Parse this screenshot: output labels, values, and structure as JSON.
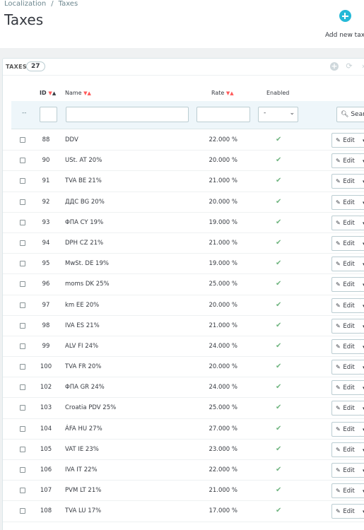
{
  "breadcrumb": {
    "items": [
      "Localization",
      "Taxes"
    ],
    "separator": "/"
  },
  "page_title": "Taxes",
  "add_button": {
    "label": "Add new tax",
    "icon": "plus-circle-icon"
  },
  "panel": {
    "title": "TAXES",
    "count": "27",
    "tools": [
      "add-icon",
      "refresh-icon",
      "chevron-right-icon"
    ]
  },
  "columns": {
    "id": "ID",
    "name": "Name",
    "rate": "Rate",
    "enabled": "Enabled"
  },
  "filters": {
    "dash": "--",
    "enabled_value": "-",
    "search_label": "Search"
  },
  "colors": {
    "accent": "#25b9d7",
    "check": "#70b580",
    "sort": "#ff5a5a"
  },
  "rows": [
    {
      "id": "88",
      "name": "DDV",
      "rate": "22.000 %",
      "enabled": true
    },
    {
      "id": "90",
      "name": "USt. AT 20%",
      "rate": "20.000 %",
      "enabled": true
    },
    {
      "id": "91",
      "name": "TVA BE 21%",
      "rate": "21.000 %",
      "enabled": true
    },
    {
      "id": "92",
      "name": "ДДС BG 20%",
      "rate": "20.000 %",
      "enabled": true
    },
    {
      "id": "93",
      "name": "ΦΠΑ CY 19%",
      "rate": "19.000 %",
      "enabled": true
    },
    {
      "id": "94",
      "name": "DPH CZ 21%",
      "rate": "21.000 %",
      "enabled": true
    },
    {
      "id": "95",
      "name": "MwSt. DE 19%",
      "rate": "19.000 %",
      "enabled": true
    },
    {
      "id": "96",
      "name": "moms DK 25%",
      "rate": "25.000 %",
      "enabled": true
    },
    {
      "id": "97",
      "name": "km EE 20%",
      "rate": "20.000 %",
      "enabled": true
    },
    {
      "id": "98",
      "name": "IVA ES 21%",
      "rate": "21.000 %",
      "enabled": true
    },
    {
      "id": "99",
      "name": "ALV FI 24%",
      "rate": "24.000 %",
      "enabled": true
    },
    {
      "id": "100",
      "name": "TVA FR 20%",
      "rate": "20.000 %",
      "enabled": true
    },
    {
      "id": "102",
      "name": "ΦΠΑ GR 24%",
      "rate": "24.000 %",
      "enabled": true
    },
    {
      "id": "103",
      "name": "Croatia PDV 25%",
      "rate": "25.000 %",
      "enabled": true
    },
    {
      "id": "104",
      "name": "ÁFA HU 27%",
      "rate": "27.000 %",
      "enabled": true
    },
    {
      "id": "105",
      "name": "VAT IE 23%",
      "rate": "23.000 %",
      "enabled": true
    },
    {
      "id": "106",
      "name": "IVA IT 22%",
      "rate": "22.000 %",
      "enabled": true
    },
    {
      "id": "107",
      "name": "PVM LT 21%",
      "rate": "21.000 %",
      "enabled": true
    },
    {
      "id": "108",
      "name": "TVA LU 17%",
      "rate": "17.000 %",
      "enabled": true
    }
  ],
  "row_actions": {
    "edit_label": "Edit"
  }
}
